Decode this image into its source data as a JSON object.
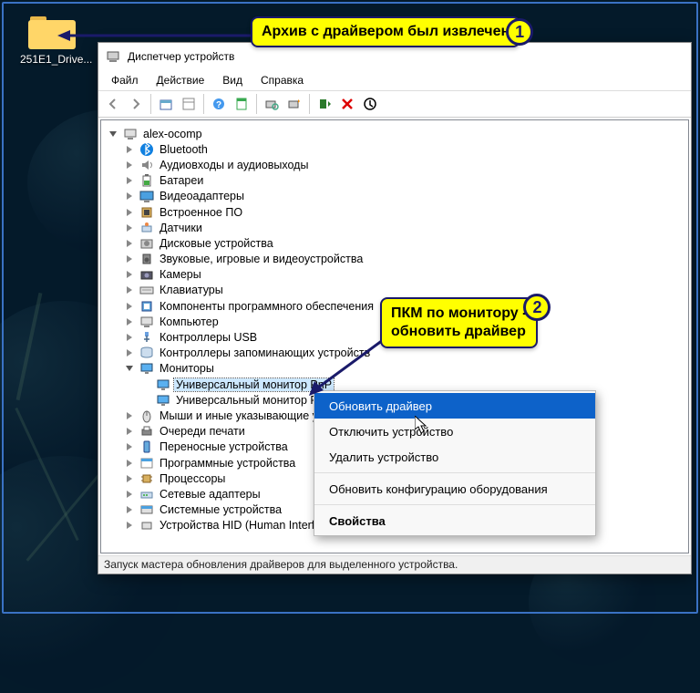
{
  "desktop": {
    "folder_label": "251E1_Drive..."
  },
  "devmgr": {
    "title": "Диспетчер устройств",
    "menu": {
      "file": "Файл",
      "action": "Действие",
      "view": "Вид",
      "help": "Справка"
    },
    "root": "alex-ocomp",
    "categories": [
      "Bluetooth",
      "Аудиовходы и аудиовыходы",
      "Батареи",
      "Видеоадаптеры",
      "Встроенное ПО",
      "Датчики",
      "Дисковые устройства",
      "Звуковые, игровые и видеоустройства",
      "Камеры",
      "Клавиатуры",
      "Компоненты программного обеспечения",
      "Компьютер",
      "Контроллеры USB",
      "Контроллеры запоминающих устройств",
      "Мониторы",
      "Мыши и иные указывающие устройства",
      "Очереди печати",
      "Переносные устройства",
      "Программные устройства",
      "Процессоры",
      "Сетевые адаптеры",
      "Системные устройства",
      "Устройства HID (Human Interface Devices)"
    ],
    "monitor_items": [
      "Универсальный монитор PnP",
      "Универсальный монитор PnP"
    ],
    "status": "Запуск мастера обновления драйверов для выделенного устройства."
  },
  "context_menu": {
    "update": "Обновить драйвер",
    "disable": "Отключить устройство",
    "remove": "Удалить устройство",
    "scan": "Обновить конфигурацию оборудования",
    "props": "Свойства"
  },
  "callouts": {
    "c1": "Архив с драйвером был извлечен",
    "c1_badge": "1",
    "c2a": "ПКМ по монитору -",
    "c2b": "обновить драйвер",
    "c2_badge": "2"
  },
  "icons": {
    "toolbar": [
      "back",
      "forward",
      "up",
      "show-hidden",
      "help",
      "properties",
      "scan",
      "add-legacy",
      "update",
      "remove",
      "uninstall"
    ]
  }
}
